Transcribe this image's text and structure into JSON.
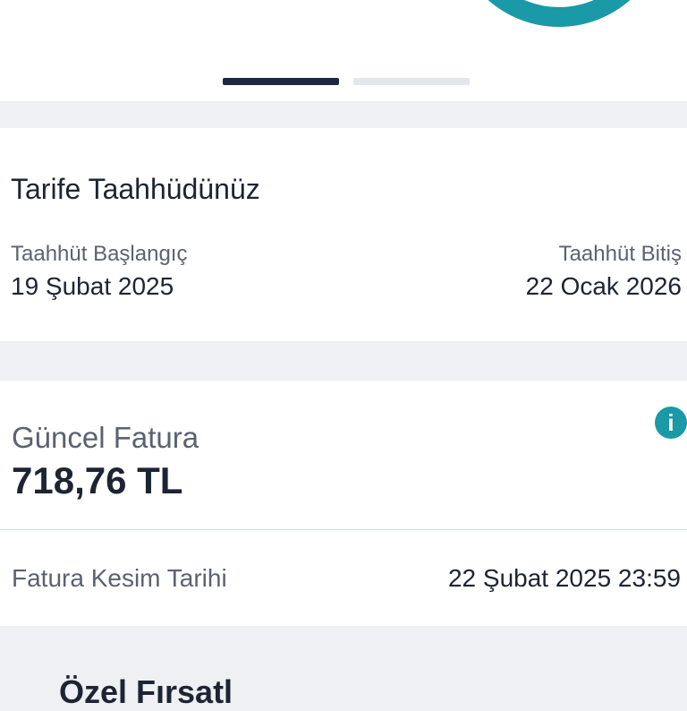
{
  "pager": {
    "count": 2,
    "active_index": 0
  },
  "commitment": {
    "title": "Tarife Taahhüdünüz",
    "start_label": "Taahhüt Başlangıç",
    "start_value": "19 Şubat 2025",
    "end_label": "Taahhüt Bitiş",
    "end_value": "22 Ocak 2026"
  },
  "bill": {
    "title": "Güncel Fatura",
    "amount": "718,76 TL",
    "info_icon": "i",
    "cutoff_label": "Fatura Kesim Tarihi",
    "cutoff_value": "22 Şubat 2025 23:59"
  },
  "next_section": {
    "title": "Özel Fırsatl"
  },
  "colors": {
    "accent": "#1a9aa6",
    "primary_text": "#1d2433",
    "secondary_text": "#5b6270",
    "page_bg": "#eef0f3"
  }
}
